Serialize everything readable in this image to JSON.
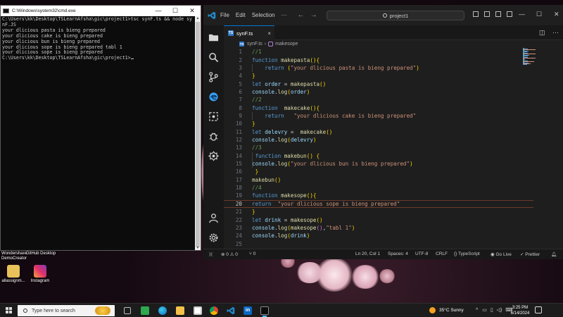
{
  "cmd": {
    "title": "C:\\Windows\\system32\\cmd.exe",
    "lines": [
      "C:\\Users\\kk\\Desktop\\TSLearnAfsha\\gic\\project1>tsc synF.ts && node sy",
      "nF.JS",
      "your dlicious pasta is bieng prepared",
      "your dlicious cake is bieng prepared",
      "your dlicious bun is bieng prepared",
      "your dlicious sope is bieng prepared tabl 1",
      "your dlicious sope is bieng prepared",
      "",
      "C:\\Users\\kk\\Desktop\\TSLearnAfsha\\gic\\project1>"
    ]
  },
  "desktop": {
    "icons": [
      {
        "label": "Wondershare DemoCreator"
      },
      {
        "label": "GitHub Desktop"
      },
      {
        "label": "allassignm..."
      },
      {
        "label": "Instagram"
      }
    ]
  },
  "vscode": {
    "menu": [
      "File",
      "Edit",
      "Selection",
      "···"
    ],
    "search": "project1",
    "tab": {
      "badge": "TS",
      "label": "synF.ts",
      "close": "×"
    },
    "breadcrumb": {
      "file": "synF.ts",
      "symbol": "makesope"
    },
    "code": [
      "//1",
      "function makepasta(){",
      "    return (\"your dlicious pasta is bieng prepared\")",
      "}",
      "let order = makepasta()",
      "console.log(order)",
      "//2",
      "function  makecake(){",
      "    return   \"your dlicious cake is bieng prepared\"",
      "}",
      "let delevry =  makecake()",
      "console.log(delevry)",
      "//3",
      " function makebun() {",
      "console.log(\"your dlicious bun is bieng prepared\")",
      " }",
      "makebun()",
      "//4",
      "function makesope(){",
      "return  \"your dlicious sope is bieng prepared\"",
      "}",
      "let drink = makesope()",
      "console.log(makesope(),\"tabl 1\")",
      "console.log(drink)",
      ""
    ],
    "active_line": 20,
    "status": {
      "problems": "⊗ 0 ⚠ 0",
      "ports": "⑂ 0",
      "position": "Ln 20, Col 1",
      "spaces": "Spaces: 4",
      "encoding": "UTF-8",
      "eol": "CRLF",
      "language": "{} TypeScript",
      "golive": "Go Live",
      "prettier": "✓ Prettier"
    }
  },
  "taskbar": {
    "search_placeholder": "Type here to search",
    "weather": "35°C  Sunny",
    "time": "3:25 PM",
    "date": "6/14/2024"
  },
  "colors": {
    "accent": "#0078d4",
    "keyword": "#569cd6",
    "function": "#dcdcaa",
    "string": "#ce9178",
    "comment": "#6a9955",
    "variable": "#9cdcfe"
  }
}
